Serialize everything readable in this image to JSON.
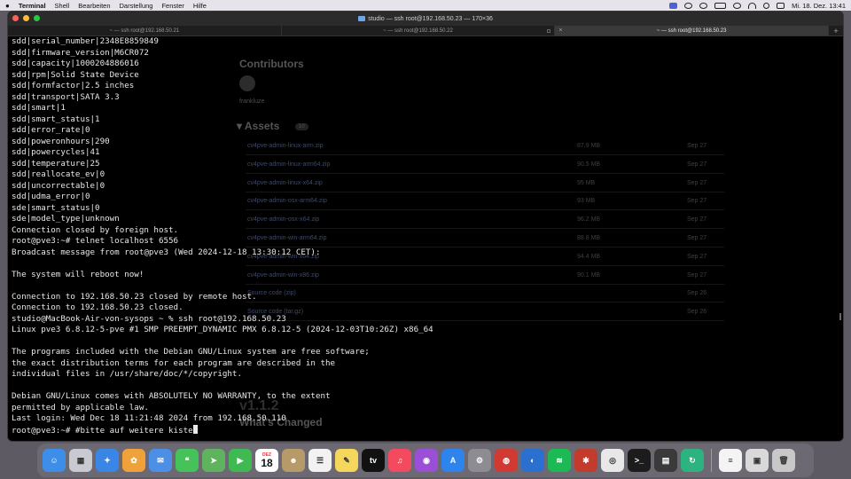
{
  "menubar": {
    "app_name": "Terminal",
    "items": [
      "Shell",
      "Bearbeiten",
      "Darstellung",
      "Fenster",
      "Hilfe"
    ],
    "clock": "Mi. 18. Dez.  13:41"
  },
  "window": {
    "title": "studio — ssh root@192.168.50.23 — 170×36",
    "tabs": [
      {
        "label": "~ — ssh root@192.168.50.21",
        "active": false
      },
      {
        "label": "~ — ssh root@192.168.50.22",
        "active": false
      },
      {
        "label": "~ — ssh root@192.168.50.23",
        "active": true
      }
    ]
  },
  "terminal": {
    "lines": [
      "sdd|serial_number|2348E8859849",
      "sdd|firmware_version|M6CR072",
      "sdd|capacity|1000204886016",
      "sdd|rpm|Solid State Device",
      "sdd|formfactor|2.5 inches",
      "sdd|transport|SATA 3.3",
      "sdd|smart|1",
      "sdd|smart_status|1",
      "sdd|error_rate|0",
      "sdd|poweronhours|290",
      "sdd|powercycles|41",
      "sdd|temperature|25",
      "sdd|reallocate_ev|0",
      "sdd|uncorrectable|0",
      "sdd|udma_error|0",
      "sde|smart_status|0",
      "sde|model_type|unknown",
      "Connection closed by foreign host.",
      "root@pve3:~# telnet localhost 6556",
      "Broadcast message from root@pve3 (Wed 2024-12-18 13:30:12 CET):",
      "",
      "The system will reboot now!",
      "",
      "Connection to 192.168.50.23 closed by remote host.",
      "Connection to 192.168.50.23 closed.",
      "studio@MacBook-Air-von-sysops ~ % ssh root@192.168.50.23",
      "Linux pve3 6.8.12-5-pve #1 SMP PREEMPT_DYNAMIC PMX 6.8.12-5 (2024-12-03T10:26Z) x86_64",
      "",
      "The programs included with the Debian GNU/Linux system are free software;",
      "the exact distribution terms for each program are described in the",
      "individual files in /usr/share/doc/*/copyright.",
      "",
      "Debian GNU/Linux comes with ABSOLUTELY NO WARRANTY, to the extent",
      "permitted by applicable law.",
      "Last login: Wed Dec 18 11:21:48 2024 from 192.168.50.110"
    ],
    "prompt_line": "root@pve3:~# #bitte auf weitere kiste"
  },
  "background_page": {
    "contributors_title": "Contributors",
    "contributor_name": "frankluze",
    "assets_title": "Assets",
    "assets_count": "10",
    "assets": [
      {
        "name": "cv4pve-admin-linux-arm.zip",
        "size": "87.9 MB",
        "date": "Sep 27"
      },
      {
        "name": "cv4pve-admin-linux-arm64.zip",
        "size": "90.5 MB",
        "date": "Sep 27"
      },
      {
        "name": "cv4pve-admin-linux-x64.zip",
        "size": "95 MB",
        "date": "Sep 27"
      },
      {
        "name": "cv4pve-admin-osx-arm64.zip",
        "size": "93 MB",
        "date": "Sep 27"
      },
      {
        "name": "cv4pve-admin-osx-x64.zip",
        "size": "96.2 MB",
        "date": "Sep 27"
      },
      {
        "name": "cv4pve-admin-win-arm64.zip",
        "size": "88.8 MB",
        "date": "Sep 27"
      },
      {
        "name": "cv4pve-admin-win-x64.zip",
        "size": "94.4 MB",
        "date": "Sep 27"
      },
      {
        "name": "cv4pve-admin-win-x86.zip",
        "size": "90.1 MB",
        "date": "Sep 27"
      },
      {
        "name": "Source code (zip)",
        "size": "",
        "date": "Sep 26"
      },
      {
        "name": "Source code (tar.gz)",
        "size": "",
        "date": "Sep 26"
      }
    ],
    "version": "v1.1.2",
    "whats_changed": "What's Changed"
  },
  "dock": {
    "calendar_month": "DEZ",
    "calendar_day": "18",
    "apps": [
      {
        "name": "finder",
        "color": "#3d8ee8",
        "glyph": "☺"
      },
      {
        "name": "launchpad",
        "color": "#c9c9d1",
        "glyph": "▦"
      },
      {
        "name": "safari",
        "color": "#3a86e6",
        "glyph": "✦"
      },
      {
        "name": "photos",
        "color": "#f0a23a",
        "glyph": "✿"
      },
      {
        "name": "mail",
        "color": "#4b8fe6",
        "glyph": "✉"
      },
      {
        "name": "messages",
        "color": "#46c25a",
        "glyph": "❝"
      },
      {
        "name": "maps",
        "color": "#5fb35e",
        "glyph": "➤"
      },
      {
        "name": "facetime",
        "color": "#3fba52",
        "glyph": "▶"
      },
      {
        "name": "calendar",
        "color": "#ffffff",
        "glyph": ""
      },
      {
        "name": "contacts",
        "color": "#b79a6a",
        "glyph": "☻"
      },
      {
        "name": "reminders",
        "color": "#f2f2f2",
        "glyph": "☰"
      },
      {
        "name": "notes",
        "color": "#f4d75c",
        "glyph": "✎"
      },
      {
        "name": "tv",
        "color": "#111111",
        "glyph": "tv"
      },
      {
        "name": "music",
        "color": "#f44a5f",
        "glyph": "♫"
      },
      {
        "name": "podcasts",
        "color": "#9a4fd6",
        "glyph": "◉"
      },
      {
        "name": "app-store",
        "color": "#2e84ec",
        "glyph": "A"
      },
      {
        "name": "system-settings",
        "color": "#8c8c92",
        "glyph": "⚙"
      },
      {
        "name": "screen-sharing",
        "color": "#d13a33",
        "glyph": "◍"
      },
      {
        "name": "proxyman",
        "color": "#2b6fd1",
        "glyph": "◐"
      },
      {
        "name": "spotify",
        "color": "#1db954",
        "glyph": "≋"
      },
      {
        "name": "app-red",
        "color": "#c23b2d",
        "glyph": "✱"
      },
      {
        "name": "chrome",
        "color": "#e8e8e8",
        "glyph": "◎"
      },
      {
        "name": "terminal",
        "color": "#1c1c1c",
        "glyph": ">_"
      },
      {
        "name": "calculator",
        "color": "#3a3a3a",
        "glyph": "▤"
      },
      {
        "name": "app-green",
        "color": "#2db37f",
        "glyph": "↻"
      }
    ],
    "right_items": [
      {
        "name": "document",
        "color": "#f4f4f4",
        "glyph": "≡"
      },
      {
        "name": "downloads",
        "color": "#d9d9d9",
        "glyph": "▣"
      },
      {
        "name": "trash",
        "color": "#c8c8c8",
        "glyph": "🗑"
      }
    ]
  }
}
